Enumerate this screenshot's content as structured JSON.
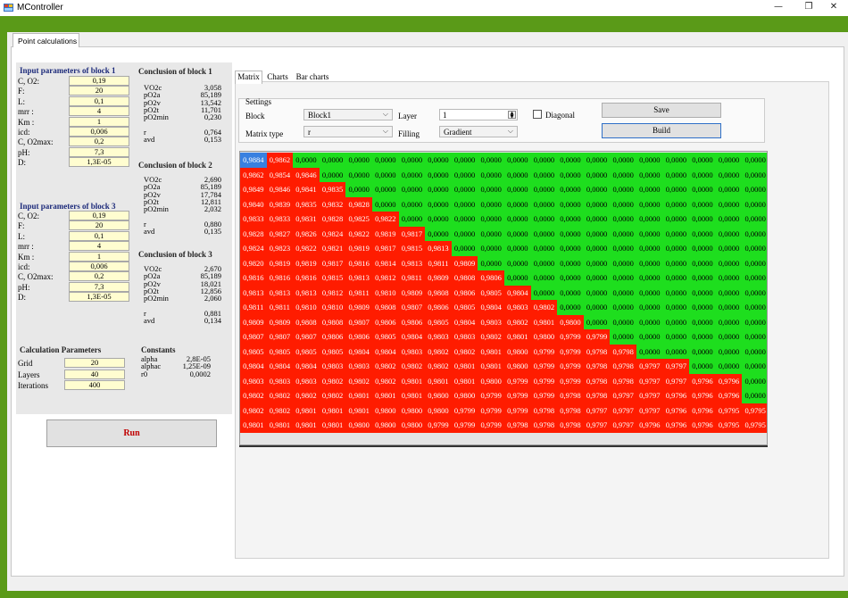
{
  "window": {
    "title": "MController",
    "minimize": "—",
    "restore": "❐",
    "close": "✕"
  },
  "main_tab": "Point calculations",
  "block1": {
    "title": "Input parameters of block 1",
    "params": [
      {
        "label": "C, O2:",
        "value": "0,19"
      },
      {
        "label": "F:",
        "value": "20"
      },
      {
        "label": "L:",
        "value": "0,1"
      },
      {
        "label": "mrr :",
        "value": "4"
      },
      {
        "label": "Km :",
        "value": "1"
      },
      {
        "label": "icd:",
        "value": "0,006"
      },
      {
        "label": "C, O2max:",
        "value": "0,2"
      },
      {
        "label": "pH:",
        "value": "7,3"
      },
      {
        "label": "D:",
        "value": "1,3E-05"
      }
    ]
  },
  "block3": {
    "title": "Input parameters of block 3",
    "params": [
      {
        "label": "C, O2:",
        "value": "0,19"
      },
      {
        "label": "F:",
        "value": "20"
      },
      {
        "label": "L:",
        "value": "0,1"
      },
      {
        "label": "mrr :",
        "value": "4"
      },
      {
        "label": "Km :",
        "value": "1"
      },
      {
        "label": "icd:",
        "value": "0,006"
      },
      {
        "label": "C, O2max:",
        "value": "0,2"
      },
      {
        "label": "pH:",
        "value": "7,3"
      },
      {
        "label": "D:",
        "value": "1,3E-05"
      }
    ]
  },
  "calc": {
    "title": "Calculation Parameters",
    "params": [
      {
        "label": "Grid",
        "value": "20"
      },
      {
        "label": "Layers",
        "value": "40"
      },
      {
        "label": "Iterations",
        "value": "400"
      }
    ]
  },
  "conclusion1": {
    "title": "Conclusion of block 1",
    "names": "VO2c\npO2a\npO2v\npO2t\npO2min\n\nr\navd",
    "values": "3,058\n85,189\n13,542\n11,701\n0,230\n\n0,764\n0,153"
  },
  "conclusion2": {
    "title": "Conclusion of block 2",
    "names": "VO2c\npO2a\npO2v\npO2t\npO2min\n\nr\navd",
    "values": "2,690\n85,189\n17,784\n12,811\n2,032\n\n0,880\n0,135"
  },
  "conclusion3": {
    "title": "Conclusion of block 3",
    "names": "VO2c\npO2a\npO2v\npO2t\npO2min\n\nr\navd",
    "values": "2,670\n85,189\n18,021\n12,856\n2,060\n\n0,881\n0,134"
  },
  "constants": {
    "title": "Constants",
    "names": "alpha\nalphac\nr0",
    "values": "2,8E-05\n1,25E-09\n0,0002"
  },
  "run_label": "Run",
  "subtabs": [
    "Matrix",
    "Charts",
    "Bar charts"
  ],
  "settings": {
    "title": "Settings",
    "block_label": "Block",
    "block_value": "Block1",
    "layer_label": "Layer",
    "layer_value": "1",
    "diagonal_label": "Diagonal",
    "matrix_type_label": "Matrix type",
    "matrix_type_value": "r",
    "filling_label": "Filling",
    "filling_value": "Gradient",
    "save_label": "Save",
    "build_label": "Build"
  },
  "colors": {
    "red": "#ff1c00",
    "green": "#1ede1e",
    "selected": "#3880e0",
    "frame_green": "#5a9a18"
  },
  "matrix_rows": [
    [
      "0,9884",
      "0,9862",
      "0,0000",
      "0,0000",
      "0,0000",
      "0,0000",
      "0,0000",
      "0,0000",
      "0,0000",
      "0,0000",
      "0,0000",
      "0,0000",
      "0,0000",
      "0,0000",
      "0,0000",
      "0,0000",
      "0,0000",
      "0,0000",
      "0,0000",
      "0,0000"
    ],
    [
      "0,9862",
      "0,9854",
      "0,9846",
      "0,0000",
      "0,0000",
      "0,0000",
      "0,0000",
      "0,0000",
      "0,0000",
      "0,0000",
      "0,0000",
      "0,0000",
      "0,0000",
      "0,0000",
      "0,0000",
      "0,0000",
      "0,0000",
      "0,0000",
      "0,0000",
      "0,0000"
    ],
    [
      "0,9849",
      "0,9846",
      "0,9841",
      "0,9835",
      "0,0000",
      "0,0000",
      "0,0000",
      "0,0000",
      "0,0000",
      "0,0000",
      "0,0000",
      "0,0000",
      "0,0000",
      "0,0000",
      "0,0000",
      "0,0000",
      "0,0000",
      "0,0000",
      "0,0000",
      "0,0000"
    ],
    [
      "0,9840",
      "0,9839",
      "0,9835",
      "0,9832",
      "0,9828",
      "0,0000",
      "0,0000",
      "0,0000",
      "0,0000",
      "0,0000",
      "0,0000",
      "0,0000",
      "0,0000",
      "0,0000",
      "0,0000",
      "0,0000",
      "0,0000",
      "0,0000",
      "0,0000",
      "0,0000"
    ],
    [
      "0,9833",
      "0,9833",
      "0,9831",
      "0,9828",
      "0,9825",
      "0,9822",
      "0,0000",
      "0,0000",
      "0,0000",
      "0,0000",
      "0,0000",
      "0,0000",
      "0,0000",
      "0,0000",
      "0,0000",
      "0,0000",
      "0,0000",
      "0,0000",
      "0,0000",
      "0,0000"
    ],
    [
      "0,9828",
      "0,9827",
      "0,9826",
      "0,9824",
      "0,9822",
      "0,9819",
      "0,9817",
      "0,0000",
      "0,0000",
      "0,0000",
      "0,0000",
      "0,0000",
      "0,0000",
      "0,0000",
      "0,0000",
      "0,0000",
      "0,0000",
      "0,0000",
      "0,0000",
      "0,0000"
    ],
    [
      "0,9824",
      "0,9823",
      "0,9822",
      "0,9821",
      "0,9819",
      "0,9817",
      "0,9815",
      "0,9813",
      "0,0000",
      "0,0000",
      "0,0000",
      "0,0000",
      "0,0000",
      "0,0000",
      "0,0000",
      "0,0000",
      "0,0000",
      "0,0000",
      "0,0000",
      "0,0000"
    ],
    [
      "0,9820",
      "0,9819",
      "0,9819",
      "0,9817",
      "0,9816",
      "0,9814",
      "0,9813",
      "0,9811",
      "0,9809",
      "0,0000",
      "0,0000",
      "0,0000",
      "0,0000",
      "0,0000",
      "0,0000",
      "0,0000",
      "0,0000",
      "0,0000",
      "0,0000",
      "0,0000"
    ],
    [
      "0,9816",
      "0,9816",
      "0,9816",
      "0,9815",
      "0,9813",
      "0,9812",
      "0,9811",
      "0,9809",
      "0,9808",
      "0,9806",
      "0,0000",
      "0,0000",
      "0,0000",
      "0,0000",
      "0,0000",
      "0,0000",
      "0,0000",
      "0,0000",
      "0,0000",
      "0,0000"
    ],
    [
      "0,9813",
      "0,9813",
      "0,9813",
      "0,9812",
      "0,9811",
      "0,9810",
      "0,9809",
      "0,9808",
      "0,9806",
      "0,9805",
      "0,9804",
      "0,0000",
      "0,0000",
      "0,0000",
      "0,0000",
      "0,0000",
      "0,0000",
      "0,0000",
      "0,0000",
      "0,0000"
    ],
    [
      "0,9811",
      "0,9811",
      "0,9810",
      "0,9810",
      "0,9809",
      "0,9808",
      "0,9807",
      "0,9806",
      "0,9805",
      "0,9804",
      "0,9803",
      "0,9802",
      "0,0000",
      "0,0000",
      "0,0000",
      "0,0000",
      "0,0000",
      "0,0000",
      "0,0000",
      "0,0000"
    ],
    [
      "0,9809",
      "0,9809",
      "0,9808",
      "0,9808",
      "0,9807",
      "0,9806",
      "0,9806",
      "0,9805",
      "0,9804",
      "0,9803",
      "0,9802",
      "0,9801",
      "0,9800",
      "0,0000",
      "0,0000",
      "0,0000",
      "0,0000",
      "0,0000",
      "0,0000",
      "0,0000"
    ],
    [
      "0,9807",
      "0,9807",
      "0,9807",
      "0,9806",
      "0,9806",
      "0,9805",
      "0,9804",
      "0,9803",
      "0,9803",
      "0,9802",
      "0,9801",
      "0,9800",
      "0,9799",
      "0,9799",
      "0,0000",
      "0,0000",
      "0,0000",
      "0,0000",
      "0,0000",
      "0,0000"
    ],
    [
      "0,9805",
      "0,9805",
      "0,9805",
      "0,9805",
      "0,9804",
      "0,9804",
      "0,9803",
      "0,9802",
      "0,9802",
      "0,9801",
      "0,9800",
      "0,9799",
      "0,9799",
      "0,9798",
      "0,9798",
      "0,0000",
      "0,0000",
      "0,0000",
      "0,0000",
      "0,0000"
    ],
    [
      "0,9804",
      "0,9804",
      "0,9804",
      "0,9803",
      "0,9803",
      "0,9802",
      "0,9802",
      "0,9802",
      "0,9801",
      "0,9801",
      "0,9800",
      "0,9799",
      "0,9799",
      "0,9798",
      "0,9798",
      "0,9797",
      "0,9797",
      "0,0000",
      "0,0000",
      "0,0000"
    ],
    [
      "0,9803",
      "0,9803",
      "0,9803",
      "0,9802",
      "0,9802",
      "0,9802",
      "0,9801",
      "0,9801",
      "0,9801",
      "0,9800",
      "0,9799",
      "0,9799",
      "0,9799",
      "0,9798",
      "0,9798",
      "0,9797",
      "0,9797",
      "0,9796",
      "0,9796",
      "0,0000"
    ],
    [
      "0,9802",
      "0,9802",
      "0,9802",
      "0,9802",
      "0,9801",
      "0,9801",
      "0,9801",
      "0,9800",
      "0,9800",
      "0,9799",
      "0,9799",
      "0,9799",
      "0,9798",
      "0,9798",
      "0,9797",
      "0,9797",
      "0,9796",
      "0,9796",
      "0,9796",
      "0,0000"
    ],
    [
      "0,9802",
      "0,9802",
      "0,9801",
      "0,9801",
      "0,9801",
      "0,9800",
      "0,9800",
      "0,9800",
      "0,9799",
      "0,9799",
      "0,9799",
      "0,9798",
      "0,9798",
      "0,9797",
      "0,9797",
      "0,9797",
      "0,9796",
      "0,9796",
      "0,9795",
      "0,9795"
    ],
    [
      "0,9801",
      "0,9801",
      "0,9801",
      "0,9801",
      "0,9800",
      "0,9800",
      "0,9800",
      "0,9799",
      "0,9799",
      "0,9799",
      "0,9798",
      "0,9798",
      "0,9798",
      "0,9797",
      "0,9797",
      "0,9796",
      "0,9796",
      "0,9796",
      "0,9795",
      "0,9795"
    ]
  ]
}
